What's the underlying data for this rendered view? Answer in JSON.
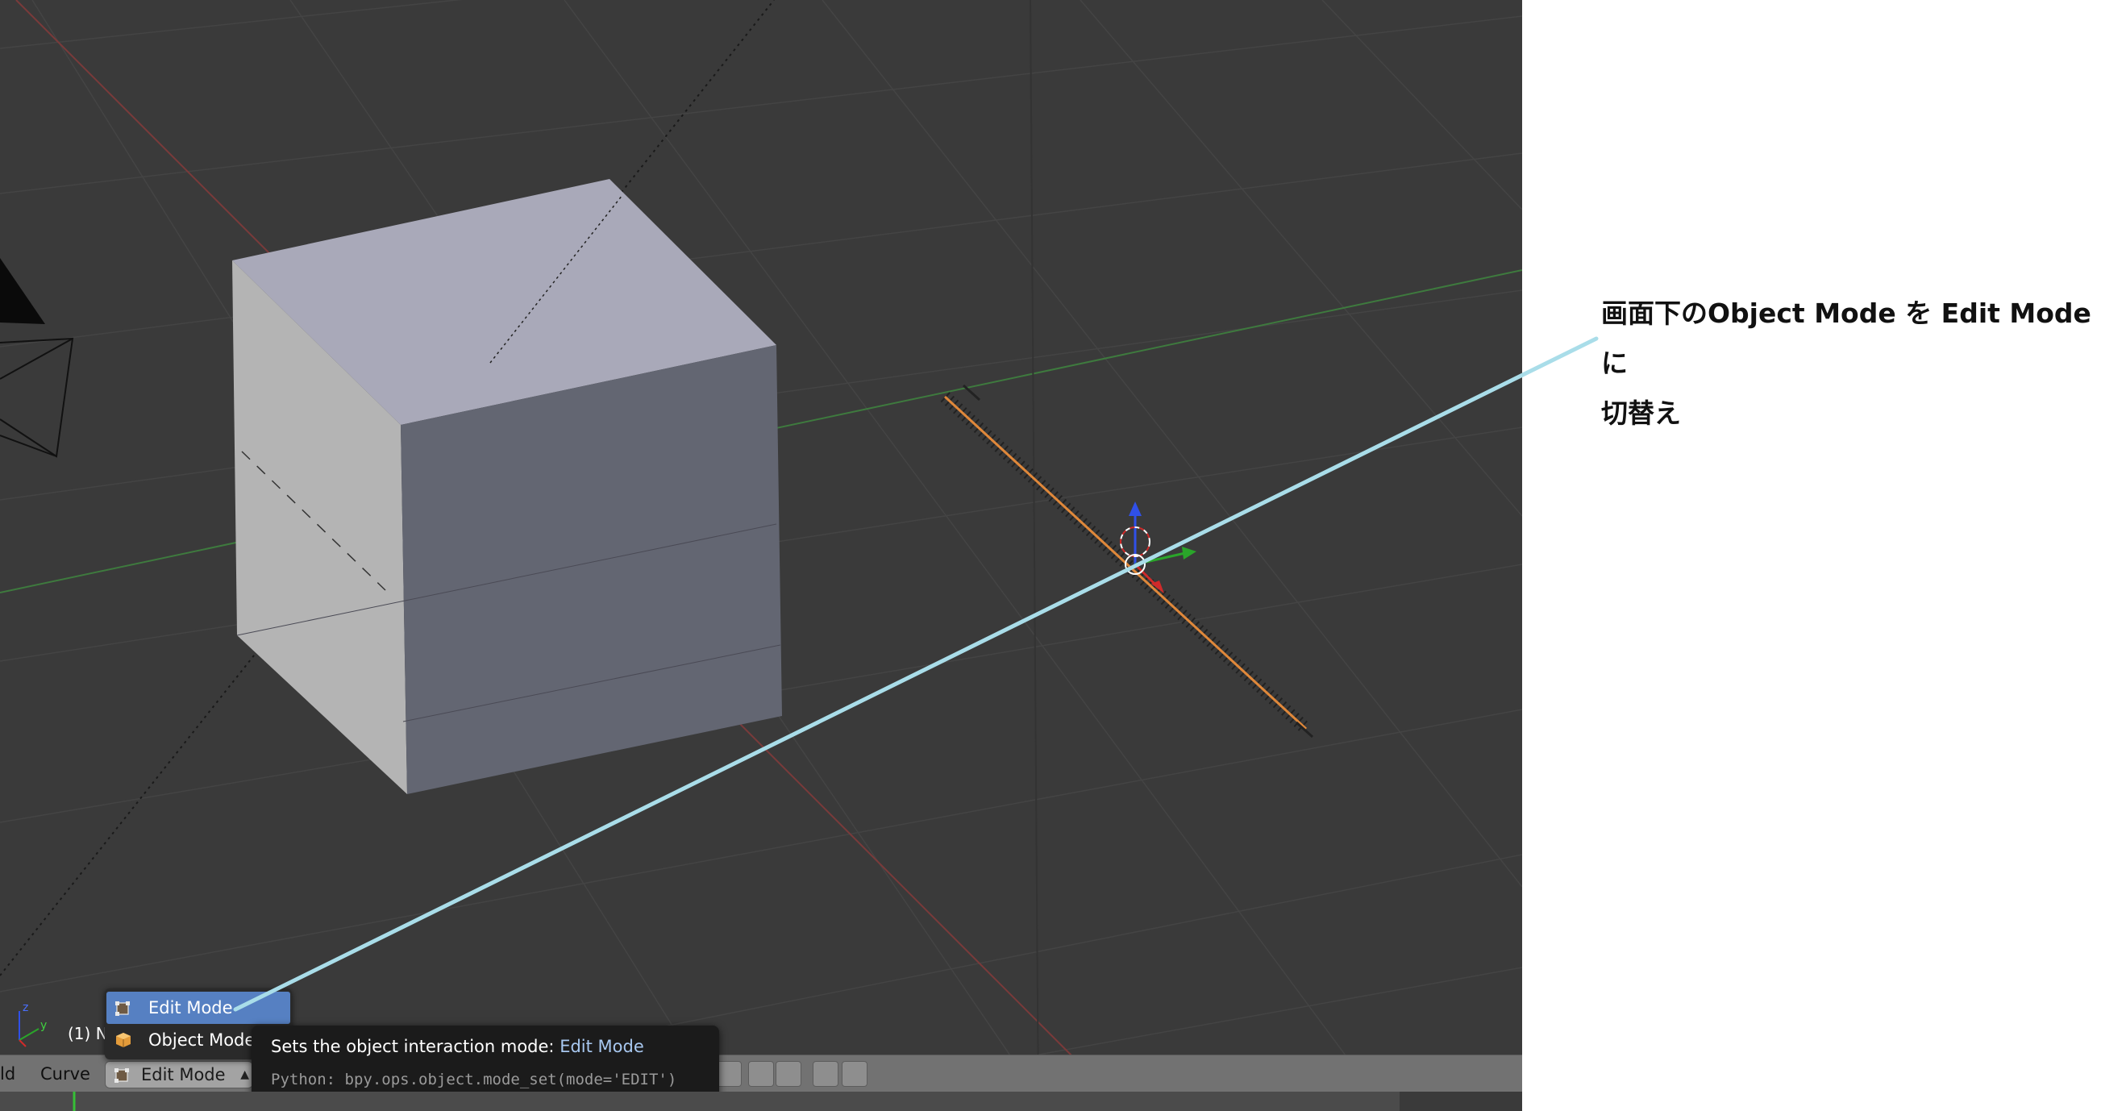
{
  "annotation": {
    "line1": "画面下のObject Mode を Edit Mode に",
    "line2": "切替え"
  },
  "viewport": {
    "object_info": "(1) N",
    "axis_labels": {
      "y": "y",
      "z": "z"
    }
  },
  "header": {
    "left_tab_fragment": "ld",
    "curve_menu": "Curve",
    "mode_value": "Edit Mode"
  },
  "mode_menu": {
    "items": [
      {
        "label": "Edit Mode",
        "icon": "edit-mode-icon",
        "selected": true
      },
      {
        "label": "Object Mode",
        "icon": "object-mode-icon",
        "selected": false
      }
    ]
  },
  "tooltip": {
    "description": "Sets the object interaction mode:",
    "value": "Edit Mode",
    "python": "Python: bpy.ops.object.mode_set(mode='EDIT')"
  },
  "colors": {
    "viewport_bg": "#3a3a3a",
    "menu_highlight": "#5680c2",
    "callout_line": "#a9dde9",
    "cube_top": "#a9a9b9",
    "cube_front": "#636672",
    "cube_side": "#b4b4b4"
  }
}
